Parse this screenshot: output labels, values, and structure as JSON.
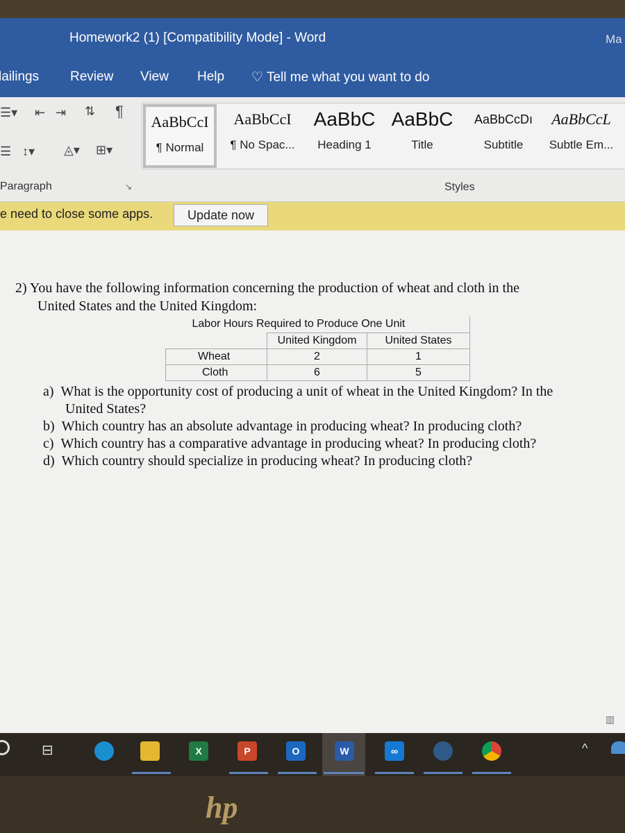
{
  "window": {
    "title": "Homework2 (1) [Compatibility Mode]  -  Word",
    "user": "Ma"
  },
  "ribbon_tabs": [
    "lailings",
    "Review",
    "View",
    "Help"
  ],
  "tell_me": "Tell me what you want to do",
  "styles": [
    {
      "preview": "AaBbCcI",
      "label": "¶ Normal"
    },
    {
      "preview": "AaBbCcI",
      "label": "¶ No Spac..."
    },
    {
      "preview": "AaBbC",
      "label": "Heading 1"
    },
    {
      "preview": "AaBbC",
      "label": "Title"
    },
    {
      "preview": "AaBbCcDı",
      "label": "Subtitle"
    },
    {
      "preview": "AaBbCcL",
      "label": "Subtle Em..."
    }
  ],
  "groups": {
    "paragraph": "Paragraph",
    "styles": "Styles"
  },
  "notice": {
    "text": "e need to close some apps.",
    "button": "Update now"
  },
  "document": {
    "question": "2)  You have the following information concerning the production of wheat and cloth in the",
    "question_cont": "United States and the United Kingdom:",
    "table": {
      "caption": "Labor Hours Required to Produce One Unit",
      "headers": [
        "",
        "United Kingdom",
        "United States"
      ],
      "rows": [
        [
          "Wheat",
          "2",
          "1"
        ],
        [
          "Cloth",
          "6",
          "5"
        ]
      ]
    },
    "parts": [
      {
        "label": "a)",
        "text": "What is the opportunity cost of producing a unit of wheat in the United Kingdom? In the",
        "cont": "United States?"
      },
      {
        "label": "b)",
        "text": "Which country has an absolute advantage in producing wheat? In producing cloth?"
      },
      {
        "label": "c)",
        "text": "Which country has a comparative advantage in producing wheat? In producing cloth?"
      },
      {
        "label": "d)",
        "text": "Which country should specialize in producing wheat? In producing cloth?"
      }
    ]
  },
  "taskbar": {
    "apps": [
      "search",
      "task-view",
      "edge",
      "file-explorer",
      "excel",
      "powerpoint",
      "outlook",
      "word",
      "app",
      "steam",
      "chrome"
    ],
    "excel": "X",
    "powerpoint": "P",
    "outlook": "O",
    "word": "W"
  },
  "colors": {
    "titlebar": "#2f5ba0",
    "notice": "#e9d97a"
  }
}
